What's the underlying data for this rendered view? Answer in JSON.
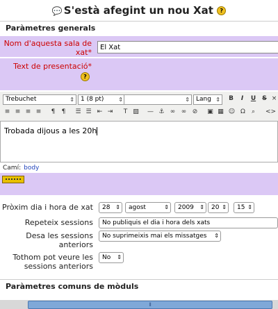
{
  "title": "S'està afegint un nou Xat",
  "icons": {
    "title_icon": "chat-bubble-icon",
    "help": "help-icon"
  },
  "colors": {
    "purple_bg": "#dbc8f5",
    "required_label": "#cc0000"
  },
  "general": {
    "heading": "Paràmetres generals",
    "name_label": "Nom d'aquesta sala de xat*",
    "name_value": "El Xat",
    "intro_label": "Text de presentació*"
  },
  "editor": {
    "font": "Trebuchet",
    "size": "1 (8 pt)",
    "style": "",
    "lang": "Lang",
    "content": "Trobada dijous a les 20h",
    "path_label": "Camí:",
    "path_value": "body"
  },
  "schedule": {
    "next_label": "Pròxim dia i hora de xat",
    "day": "28",
    "month": "agost",
    "year": "2009",
    "hour": "20",
    "minute": "15",
    "repeat_label": "Repeteix sessions",
    "repeat_value": "No publiquis el dia i hora dels xats",
    "save_label": "Desa les sessions anteriors",
    "save_value": "No suprimeixis mai els missatges",
    "everyone_label": "Tothom pot veure les sessions anteriors",
    "everyone_value": "No"
  },
  "modules": {
    "heading": "Paràmetres comuns de mòduls"
  }
}
